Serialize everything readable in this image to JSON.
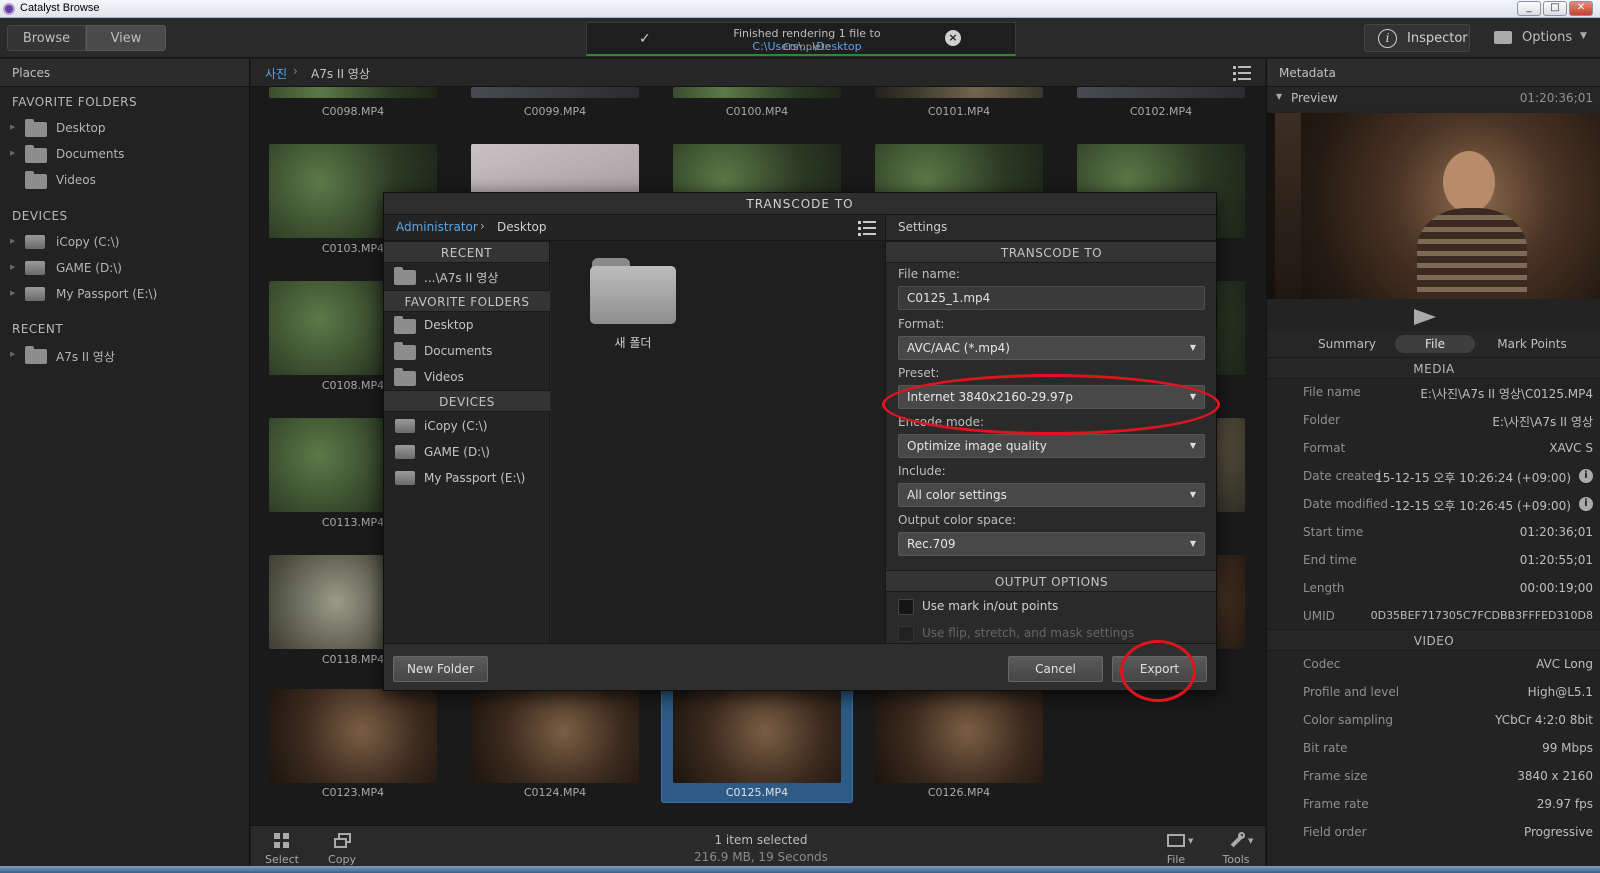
{
  "window": {
    "title": "Catalyst Browse",
    "controls": [
      "_",
      "□",
      "✕"
    ]
  },
  "toolbar": {
    "browse_label": "Browse",
    "view_label": "View",
    "notification": {
      "message_prefix": "Finished rendering 1 file to ",
      "message_path": "C:\\Users\\...\\Desktop",
      "status": "Complete"
    },
    "inspector_label": "Inspector",
    "options_label": "Options"
  },
  "places": {
    "header": "Places",
    "favorite_header": "FAVORITE FOLDERS",
    "favorites": [
      "Desktop",
      "Documents",
      "Videos"
    ],
    "devices_header": "DEVICES",
    "devices": [
      "iCopy (C:\\)",
      "GAME (D:\\)",
      "My Passport (E:\\)"
    ],
    "recent_header": "RECENT",
    "recent": [
      "A7s II 영상"
    ]
  },
  "browser": {
    "breadcrumb": [
      "사진",
      "A7s II 영상"
    ],
    "rows": [
      [
        "C0098.MP4",
        "C0099.MP4",
        "C0100.MP4",
        "C0101.MP4",
        "C0102.MP4"
      ],
      [
        "C0103.MP4",
        "",
        "",
        "",
        ""
      ],
      [
        "C0108.MP4",
        "",
        "",
        "",
        ""
      ],
      [
        "C0113.MP4",
        "",
        "",
        "",
        ""
      ],
      [
        "C0118.MP4",
        "",
        "",
        "",
        ""
      ],
      [
        "C0123.MP4",
        "C0124.MP4",
        "C0125.MP4",
        "C0126.MP4"
      ]
    ],
    "selected": "C0125.MP4"
  },
  "bottombar": {
    "select_label": "Select",
    "copy_label": "Copy",
    "status_line1": "1 item selected",
    "status_line2": "216.9 MB, 19 Seconds",
    "file_label": "File",
    "tools_label": "Tools"
  },
  "metadata": {
    "header": "Metadata",
    "preview_label": "Preview",
    "timecode": "01:20:36;01",
    "tabs": [
      "Summary",
      "File",
      "Mark Points"
    ],
    "active_tab": "File",
    "media_header": "MEDIA",
    "media": [
      {
        "k": "File name",
        "v": "E:\\사진\\A7s II 영상\\C0125.MP4"
      },
      {
        "k": "Folder",
        "v": "E:\\사진\\A7s II 영상"
      },
      {
        "k": "Format",
        "v": "XAVC S"
      },
      {
        "k": "Date created",
        "v": "15-12-15 오후 10:26:24 (+09:00)"
      },
      {
        "k": "Date modified",
        "v": "-12-15 오후 10:26:45 (+09:00)"
      },
      {
        "k": "Start time",
        "v": "01:20:36;01"
      },
      {
        "k": "End time",
        "v": "01:20:55;01"
      },
      {
        "k": "Length",
        "v": "00:00:19;00"
      },
      {
        "k": "UMID",
        "v": "0D35BEF717305C7FCDBB3FFFED310D8"
      }
    ],
    "video_header": "VIDEO",
    "video": [
      {
        "k": "Codec",
        "v": "AVC Long"
      },
      {
        "k": "Profile and level",
        "v": "High@L5.1"
      },
      {
        "k": "Color sampling",
        "v": "YCbCr 4:2:0 8bit"
      },
      {
        "k": "Bit rate",
        "v": "99 Mbps"
      },
      {
        "k": "Frame size",
        "v": "3840 x 2160"
      },
      {
        "k": "Frame rate",
        "v": "29.97 fps"
      },
      {
        "k": "Field order",
        "v": "Progressive"
      }
    ]
  },
  "dialog": {
    "title": "TRANSCODE TO",
    "breadcrumb": [
      "Administrator",
      "Desktop"
    ],
    "recent_header": "RECENT",
    "recent": [
      "...\\A7s II 영상"
    ],
    "favorite_header": "FAVORITE FOLDERS",
    "favorites": [
      "Desktop",
      "Documents",
      "Videos"
    ],
    "devices_header": "DEVICES",
    "devices": [
      "iCopy (C:\\)",
      "GAME (D:\\)",
      "My Passport (E:\\)"
    ],
    "folder_item": "새 폴더",
    "settings_label": "Settings",
    "settings_header": "TRANSCODE TO",
    "file_name_label": "File name:",
    "file_name_value": "C0125_1.mp4",
    "format_label": "Format:",
    "format_value": "AVC/AAC (*.mp4)",
    "preset_label": "Preset:",
    "preset_value": "Internet 3840x2160-29.97p",
    "encode_label": "Encode mode:",
    "encode_value": "Optimize image quality",
    "include_label": "Include:",
    "include_value": "All color settings",
    "colorspace_label": "Output color space:",
    "colorspace_value": "Rec.709",
    "output_header": "OUTPUT OPTIONS",
    "opt_mark": "Use mark in/out points",
    "opt_flip": "Use flip, stretch, and mask settings",
    "new_folder_label": "New Folder",
    "cancel_label": "Cancel",
    "export_label": "Export"
  },
  "colors": {
    "accent_blue": "#5aa6e8",
    "annotation_red": "#e0141e",
    "success_green": "#2b8a2b"
  }
}
